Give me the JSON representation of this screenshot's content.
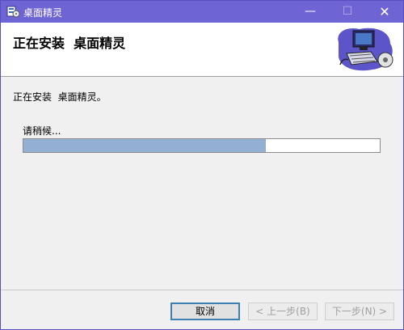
{
  "window": {
    "title": "桌面精灵"
  },
  "header": {
    "title": "正在安装  桌面精灵"
  },
  "main": {
    "status_text": "正在安装  桌面精灵。",
    "wait_text": "请稍候...",
    "progress_fraction": 0.68
  },
  "buttons": {
    "cancel": "取消",
    "back": "< 上一步(B)",
    "next": "下一步(N) >"
  },
  "titlebar_controls": {
    "minimize": "—",
    "maximize": "☐",
    "close": "✕"
  },
  "colors": {
    "titlebar": "#6f64d3",
    "progress_fill": "#93b0d3"
  },
  "icons": [
    "installer-app-icon",
    "computer-setup-graphic-icon"
  ]
}
